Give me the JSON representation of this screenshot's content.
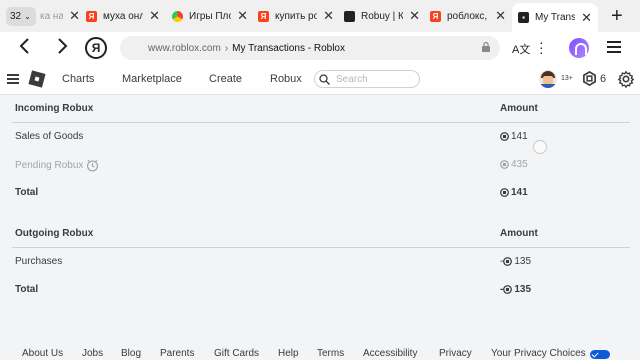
{
  "browser": {
    "tab_count": "32",
    "tabs": [
      {
        "title": "ка на",
        "favicon": "yandex-icon",
        "color": "#fc3f1d"
      },
      {
        "title": "муха онла",
        "favicon": "yandex-icon",
        "color": "#fc3f1d"
      },
      {
        "title": "Игры Пло",
        "favicon": "yandex-games-icon",
        "color": "#ffcc00"
      },
      {
        "title": "купить ро",
        "favicon": "yandex-icon",
        "color": "#fc3f1d"
      },
      {
        "title": "Robuy | Ку",
        "favicon": "shield-icon",
        "color": "#222222"
      },
      {
        "title": "роблокс, т",
        "favicon": "yandex-icon",
        "color": "#fc3f1d"
      },
      {
        "title": "My Transa",
        "favicon": "roblox-icon",
        "color": "#222222",
        "active": true
      }
    ],
    "address": {
      "host": "www.roblox.com",
      "separator": "›",
      "page_title": "My Transactions - Roblox"
    },
    "translate_label": "A文"
  },
  "header": {
    "nav": [
      "Charts",
      "Marketplace",
      "Create",
      "Robux"
    ],
    "search_placeholder": "Search",
    "age_badge": "13+",
    "robux_balance": "6"
  },
  "incoming": {
    "title": "Incoming Robux",
    "amount_header": "Amount",
    "rows": [
      {
        "label": "Sales of Goods",
        "value": "141"
      },
      {
        "label": "Pending Robux",
        "value": "435"
      },
      {
        "label": "Total",
        "value": "141"
      }
    ]
  },
  "outgoing": {
    "title": "Outgoing Robux",
    "amount_header": "Amount",
    "rows": [
      {
        "label": "Purchases",
        "value": "135",
        "sign": "-"
      },
      {
        "label": "Total",
        "value": "135",
        "sign": "-"
      }
    ]
  },
  "footer": {
    "links": [
      "About Us",
      "Jobs",
      "Blog",
      "Parents",
      "Gift Cards",
      "Help",
      "Terms",
      "Accessibility",
      "Privacy",
      "Your Privacy Choices"
    ]
  }
}
